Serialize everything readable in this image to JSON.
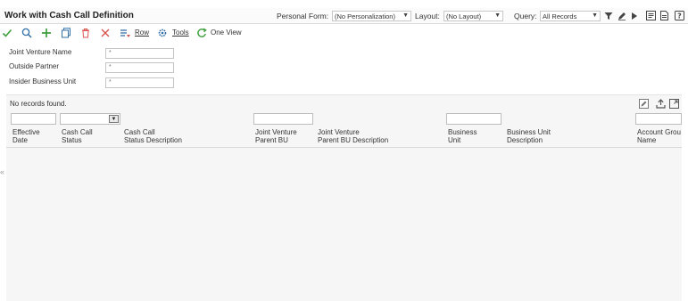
{
  "header": {
    "title": "Work with Cash Call Definition",
    "personal_form_label": "Personal Form:",
    "personal_form_value": "(No Personalization)",
    "layout_label": "Layout:",
    "layout_value": "(No Layout)",
    "query_label": "Query:",
    "query_value": "All Records"
  },
  "toolbar": {
    "row_label": "Row",
    "tools_label": "Tools",
    "one_view_label": "One View"
  },
  "form": {
    "fields": [
      {
        "label": "Joint Venture Name",
        "value": "*"
      },
      {
        "label": "Outside Partner",
        "value": "*"
      },
      {
        "label": "Insider Business Unit",
        "value": "*"
      }
    ]
  },
  "grid": {
    "message": "No records found.",
    "columns": [
      {
        "line1": "Effective",
        "line2": "Date"
      },
      {
        "line1": "Cash Call",
        "line2": "Status"
      },
      {
        "line1": "Cash Call",
        "line2": "Status Description"
      },
      {
        "line1": "Joint Venture",
        "line2": "Parent BU"
      },
      {
        "line1": "Joint Venture",
        "line2": "Parent BU Description"
      },
      {
        "line1": "Business",
        "line2": "Unit"
      },
      {
        "line1": "Business Unit",
        "line2": "Description"
      },
      {
        "line1": "Account Grou",
        "line2": "Name"
      }
    ]
  },
  "colors": {
    "accent_green": "#3f9f3f",
    "delete_red": "#d9534f",
    "icon_blue": "#2f6ea6",
    "icon_dark": "#4a4a4a"
  }
}
